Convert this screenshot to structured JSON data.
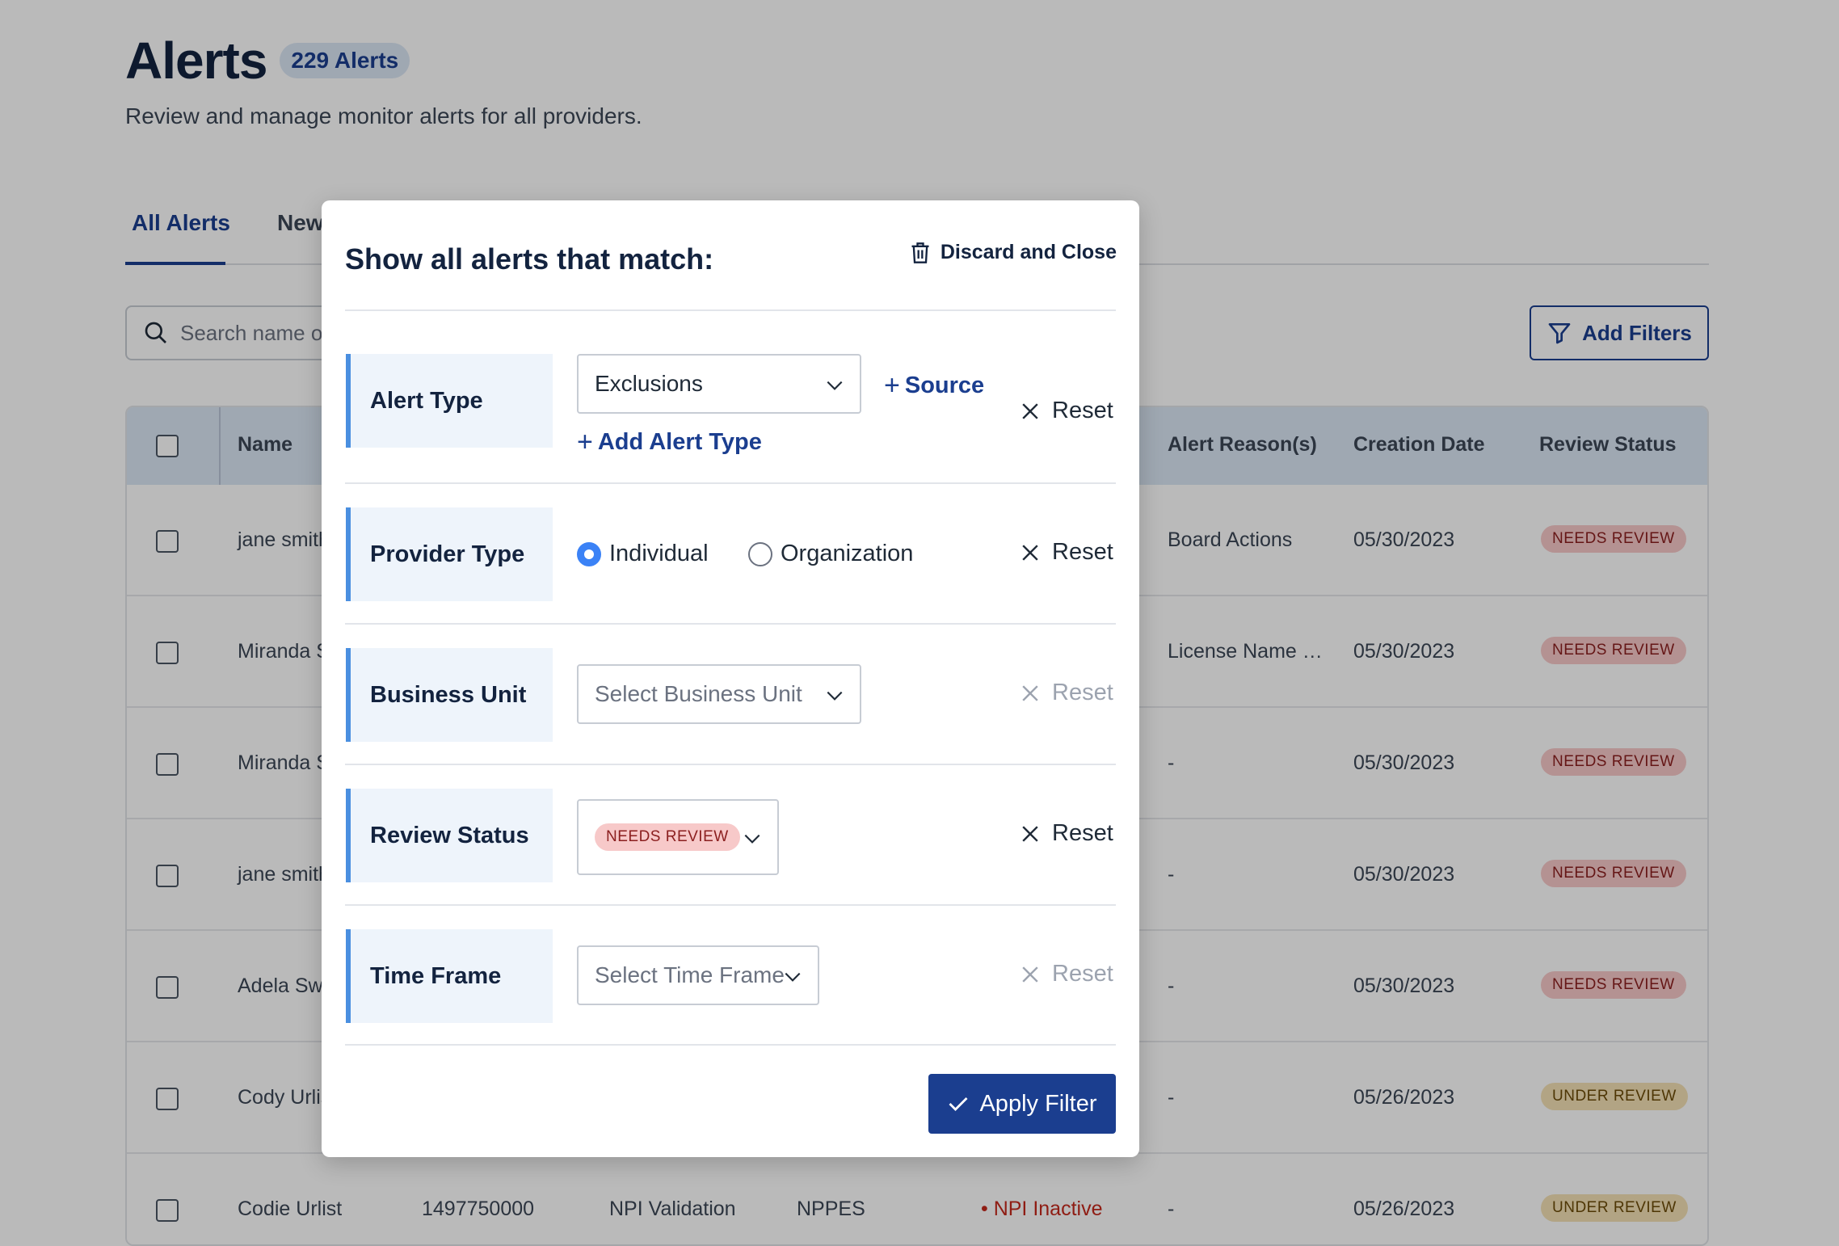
{
  "header": {
    "title": "Alerts",
    "count_badge": "229 Alerts",
    "subtitle": "Review and manage monitor alerts for all providers."
  },
  "tabs": [
    {
      "label": "All Alerts",
      "active": true
    },
    {
      "label": "New",
      "active": false
    }
  ],
  "search": {
    "placeholder": "Search name or I"
  },
  "toolbar": {
    "add_filters_label": "Add Filters"
  },
  "table": {
    "columns": {
      "name": "Name",
      "alert_reasons": "Alert Reason(s)",
      "creation_date": "Creation Date",
      "review_status": "Review Status"
    },
    "rows": [
      {
        "name": "jane smith",
        "npi": "",
        "alert_type": "",
        "source": "",
        "alert": "",
        "reason": "Board Actions",
        "date": "05/30/2023",
        "status": "NEEDS REVIEW"
      },
      {
        "name": "Miranda S",
        "npi": "",
        "alert_type": "",
        "source": "",
        "alert": "",
        "reason": "License Name …",
        "date": "05/30/2023",
        "status": "NEEDS REVIEW"
      },
      {
        "name": "Miranda S",
        "npi": "",
        "alert_type": "",
        "source": "",
        "alert": "",
        "reason": "-",
        "date": "05/30/2023",
        "status": "NEEDS REVIEW"
      },
      {
        "name": "jane smith",
        "npi": "",
        "alert_type": "",
        "source": "",
        "alert": "",
        "reason": "-",
        "date": "05/30/2023",
        "status": "NEEDS REVIEW"
      },
      {
        "name": "Adela Swi",
        "npi": "",
        "alert_type": "",
        "source": "",
        "alert": "",
        "reason": "-",
        "date": "05/30/2023",
        "status": "NEEDS REVIEW"
      },
      {
        "name": "Cody Urlis",
        "npi": "",
        "alert_type": "",
        "source": "",
        "alert": "",
        "reason": "-",
        "date": "05/26/2023",
        "status": "UNDER REVIEW"
      },
      {
        "name": "Codie Urlist",
        "npi": "1497750000",
        "alert_type": "NPI Validation",
        "source": "NPPES",
        "alert": "• NPI Inactive",
        "reason": "-",
        "date": "05/26/2023",
        "status": "UNDER REVIEW"
      }
    ]
  },
  "modal": {
    "title": "Show all alerts that match:",
    "discard_label": "Discard and Close",
    "reset_label": "Reset",
    "apply_label": "Apply Filter",
    "filters": {
      "alert_type": {
        "label": "Alert Type",
        "value": "Exclusions",
        "source_link": "Source",
        "add_link": "Add Alert Type"
      },
      "provider_type": {
        "label": "Provider Type",
        "options": [
          "Individual",
          "Organization"
        ],
        "selected": "Individual"
      },
      "business_unit": {
        "label": "Business Unit",
        "placeholder": "Select Business Unit"
      },
      "review_status": {
        "label": "Review Status",
        "chip": "NEEDS REVIEW"
      },
      "time_frame": {
        "label": "Time Frame",
        "placeholder": "Select Time Frame"
      }
    }
  },
  "colors": {
    "brand": "#1b3e8f",
    "accent_border": "#4a8fe0",
    "needs_review_bg": "#f7c9c9",
    "under_review_bg": "#f4e1b6",
    "danger": "#c5281c"
  }
}
